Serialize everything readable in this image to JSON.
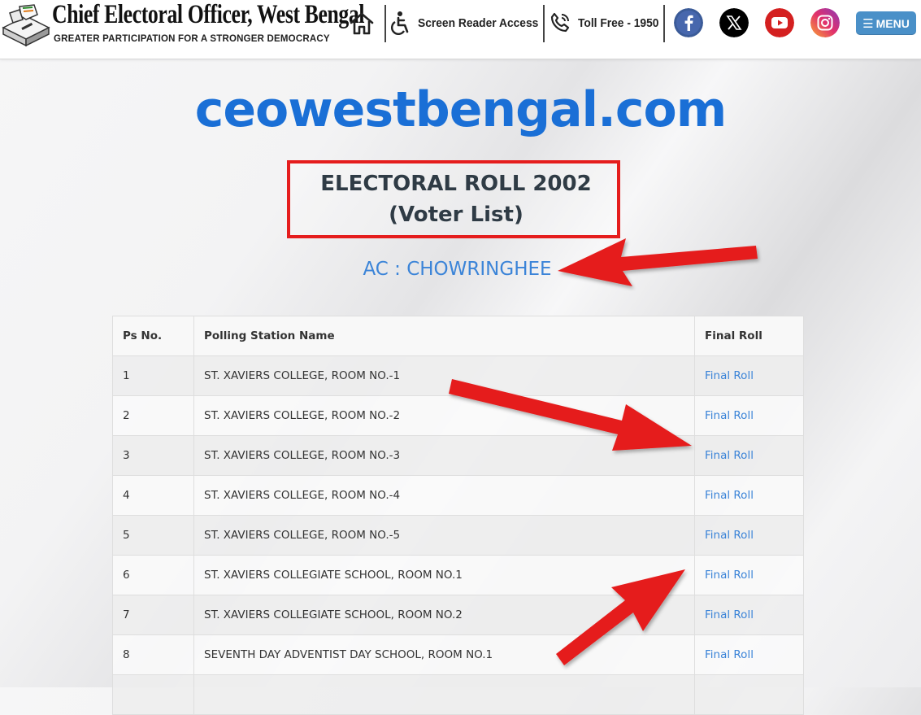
{
  "header": {
    "title": "Chief Electoral Officer, West Bengal",
    "tagline": "GREATER PARTICIPATION FOR A STRONGER DEMOCRACY",
    "screen_reader_label": "Screen Reader Access",
    "toll_free_label": "Toll Free - 1950",
    "menu_label": "MENU",
    "icons": {
      "home": "home-icon",
      "accessibility": "accessibility-icon",
      "phone": "phone-icon",
      "facebook": "facebook-icon",
      "x": "x-icon",
      "youtube": "youtube-icon",
      "instagram": "instagram-icon",
      "menu": "hamburger-icon"
    }
  },
  "main": {
    "domain_heading": "ceowestbengal.com",
    "roll_title_line1": "ELECTORAL ROLL 2002",
    "roll_title_line2": "(Voter List)",
    "ac_label": "AC : CHOWRINGHEE"
  },
  "table": {
    "headers": [
      "Ps No.",
      "Polling Station Name",
      "Final Roll"
    ],
    "rows": [
      {
        "ps_no": "1",
        "name": "ST. XAVIERS COLLEGE, ROOM NO.-1",
        "link": "Final Roll"
      },
      {
        "ps_no": "2",
        "name": "ST. XAVIERS COLLEGE, ROOM NO.-2",
        "link": "Final Roll"
      },
      {
        "ps_no": "3",
        "name": "ST. XAVIERS COLLEGE, ROOM NO.-3",
        "link": "Final Roll"
      },
      {
        "ps_no": "4",
        "name": "ST. XAVIERS COLLEGE, ROOM NO.-4",
        "link": "Final Roll"
      },
      {
        "ps_no": "5",
        "name": "ST. XAVIERS COLLEGE, ROOM NO.-5",
        "link": "Final Roll"
      },
      {
        "ps_no": "6",
        "name": "ST. XAVIERS COLLEGIATE SCHOOL, ROOM NO.1",
        "link": "Final Roll"
      },
      {
        "ps_no": "7",
        "name": "ST. XAVIERS COLLEGIATE SCHOOL, ROOM NO.2",
        "link": "Final Roll"
      },
      {
        "ps_no": "8",
        "name": "SEVENTH DAY ADVENTIST DAY SCHOOL, ROOM NO.1",
        "link": "Final Roll"
      }
    ]
  },
  "colors": {
    "brand_blue": "#1a6fd6",
    "link_blue": "#3b84d8",
    "annotation_red": "#e51d1d",
    "menu_button": "#4a90c8"
  }
}
